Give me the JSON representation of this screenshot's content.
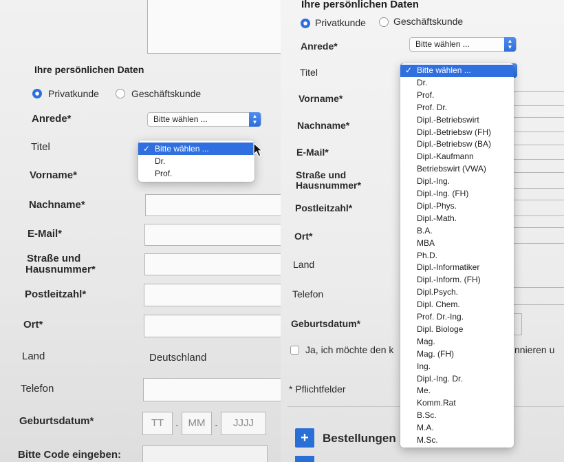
{
  "left": {
    "section_title": "Ihre persönlichen Daten",
    "customer_type": {
      "private": "Privatkunde",
      "business": "Geschäftskunde",
      "selected": "private"
    },
    "salutation": {
      "label": "Anrede*",
      "value": "Bitte wählen ..."
    },
    "title": {
      "label": "Titel",
      "dropdown": [
        {
          "label": "Bitte wählen ...",
          "selected": true
        },
        {
          "label": "Dr.",
          "selected": false
        },
        {
          "label": "Prof.",
          "selected": false
        }
      ]
    },
    "first_name": {
      "label": "Vorname*"
    },
    "last_name": {
      "label": "Nachname*"
    },
    "email": {
      "label": "E-Mail*"
    },
    "street": {
      "label_line1": "Straße und",
      "label_line2": "Hausnummer*"
    },
    "postal_code": {
      "label": "Postleitzahl*"
    },
    "city": {
      "label": "Ort*"
    },
    "country": {
      "label": "Land",
      "value": "Deutschland"
    },
    "phone": {
      "label": "Telefon"
    },
    "birth_date": {
      "label": "Geburtsdatum*",
      "day": "TT",
      "month": "MM",
      "year": "JJJJ"
    },
    "code": {
      "label": "Bitte Code eingeben:"
    }
  },
  "right": {
    "section_title": "Ihre persönlichen Daten",
    "customer_type": {
      "private": "Privatkunde",
      "business": "Geschäftskunde",
      "selected": "private"
    },
    "salutation": {
      "label": "Anrede*",
      "value": "Bitte wählen ..."
    },
    "title": {
      "label": "Titel",
      "dropdown": [
        {
          "label": "Bitte wählen ...",
          "selected": true
        },
        {
          "label": "Dr.",
          "selected": false
        },
        {
          "label": "Prof.",
          "selected": false
        },
        {
          "label": "Prof. Dr.",
          "selected": false
        },
        {
          "label": "Dipl.-Betriebswirt",
          "selected": false
        },
        {
          "label": "Dipl.-Betriebsw (FH)",
          "selected": false
        },
        {
          "label": "Dipl.-Betriebsw (BA)",
          "selected": false
        },
        {
          "label": "Dipl.-Kaufmann",
          "selected": false
        },
        {
          "label": "Betriebswirt (VWA)",
          "selected": false
        },
        {
          "label": "Dipl.-Ing.",
          "selected": false
        },
        {
          "label": "Dipl.-Ing. (FH)",
          "selected": false
        },
        {
          "label": "Dipl.-Phys.",
          "selected": false
        },
        {
          "label": "Dipl.-Math.",
          "selected": false
        },
        {
          "label": "B.A.",
          "selected": false
        },
        {
          "label": "MBA",
          "selected": false
        },
        {
          "label": "Ph.D.",
          "selected": false
        },
        {
          "label": "Dipl.-Informatiker",
          "selected": false
        },
        {
          "label": "Dipl.-Inform. (FH)",
          "selected": false
        },
        {
          "label": "Dipl.Psych.",
          "selected": false
        },
        {
          "label": "Dipl. Chem.",
          "selected": false
        },
        {
          "label": "Prof. Dr.-Ing.",
          "selected": false
        },
        {
          "label": "Dipl. Biologe",
          "selected": false
        },
        {
          "label": "Mag.",
          "selected": false
        },
        {
          "label": "Mag. (FH)",
          "selected": false
        },
        {
          "label": "Ing.",
          "selected": false
        },
        {
          "label": "Dipl.-Ing. Dr.",
          "selected": false
        },
        {
          "label": "Me.",
          "selected": false
        },
        {
          "label": "Komm.Rat",
          "selected": false
        },
        {
          "label": "B.Sc.",
          "selected": false
        },
        {
          "label": "M.A.",
          "selected": false
        },
        {
          "label": "M.Sc.",
          "selected": false
        }
      ]
    },
    "first_name": {
      "label": "Vorname*"
    },
    "last_name": {
      "label": "Nachname*"
    },
    "email": {
      "label": "E-Mail*"
    },
    "street": {
      "label_line1": "Straße und",
      "label_line2": "Hausnummer*"
    },
    "postal_code": {
      "label": "Postleitzahl*"
    },
    "city": {
      "label": "Ort*"
    },
    "country": {
      "label": "Land"
    },
    "phone": {
      "label": "Telefon"
    },
    "birth_date": {
      "label": "Geburtsdatum*"
    },
    "newsletter": {
      "label_start": "Ja, ich möchte den k",
      "label_end": "nnieren u"
    },
    "required_note": "* Pflichtfelder",
    "orders": {
      "plus": "+",
      "label": "Bestellungen"
    }
  },
  "colors": {
    "accent": "#2f6fe0",
    "stepper": "#2d6ed9",
    "button": "#2a6fd6"
  },
  "icons": {
    "check": "✓",
    "stepper_up": "▲",
    "stepper_down": "▼"
  }
}
